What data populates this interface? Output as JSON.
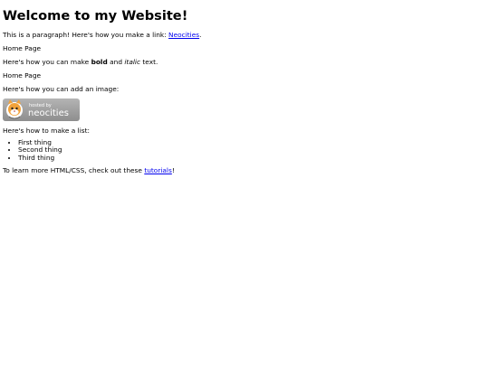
{
  "page": {
    "heading": "Welcome to my Website!",
    "para1_text": "This is a paragraph! Here's how you make a link: ",
    "para1_link": "Neocities",
    "para1_end": ".",
    "home1": "Home Page",
    "para2_pre": "Here's how you can make ",
    "para2_bold": "bold",
    "para2_mid": " and ",
    "para2_italic": "italic",
    "para2_end": " text.",
    "home2": "Home Page",
    "image_intro": "Here's how you can add an image:",
    "badge": {
      "small_text": "hosted by",
      "big_text": "neocities",
      "colors": {
        "background": "#a3a3a3",
        "text": "#ffffff",
        "cat_orange": "#f2a23a"
      }
    },
    "list_intro": "Here's how to make a list:",
    "list_items": [
      "First thing",
      "Second thing",
      "Third thing"
    ],
    "learn_pre": "To learn more HTML/CSS, check out these ",
    "learn_link": "tutorials",
    "learn_end": "!"
  }
}
